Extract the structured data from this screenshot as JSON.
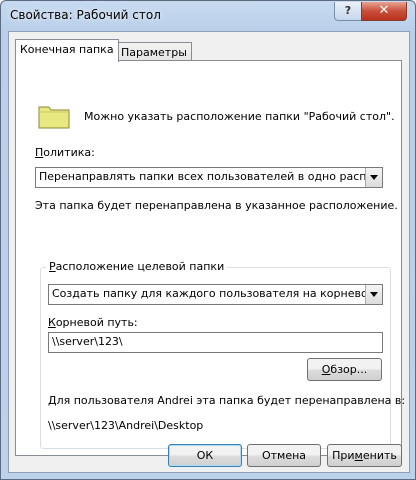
{
  "window": {
    "title": "Свойства: Рабочий стол",
    "help_glyph": "?",
    "close_glyph": "✕"
  },
  "tabs": [
    {
      "label": "Конечная папка",
      "active": true
    },
    {
      "label": "Параметры",
      "active": false
    }
  ],
  "header": {
    "description": "Можно указать расположение папки \"Рабочий стол\"."
  },
  "policy": {
    "label": "Политика:",
    "selected": "Перенаправлять папки всех пользователей в одно расположение",
    "note": "Эта папка будет перенаправлена в указанное расположение."
  },
  "target": {
    "group_label": "Расположение целевой папки",
    "selected": "Создать папку для каждого пользователя на корневом пути",
    "root_label": "Корневой путь:",
    "root_value": "\\\\server\\123\\",
    "browse_label": "Обзор...",
    "info_text": "Для пользователя Andrei эта папка будет перенаправлена в:",
    "example_path": "\\\\server\\123\\Andrei\\Desktop"
  },
  "buttons": {
    "ok": "ОК",
    "cancel": "Отмена",
    "apply": "Применить"
  },
  "icons": {
    "folder": "folder-icon",
    "help": "help-icon",
    "close": "close-icon"
  },
  "colors": {
    "folder_fill": "#e8e880",
    "title_bar": "#b9cfe9",
    "close_red": "#c9503b"
  }
}
